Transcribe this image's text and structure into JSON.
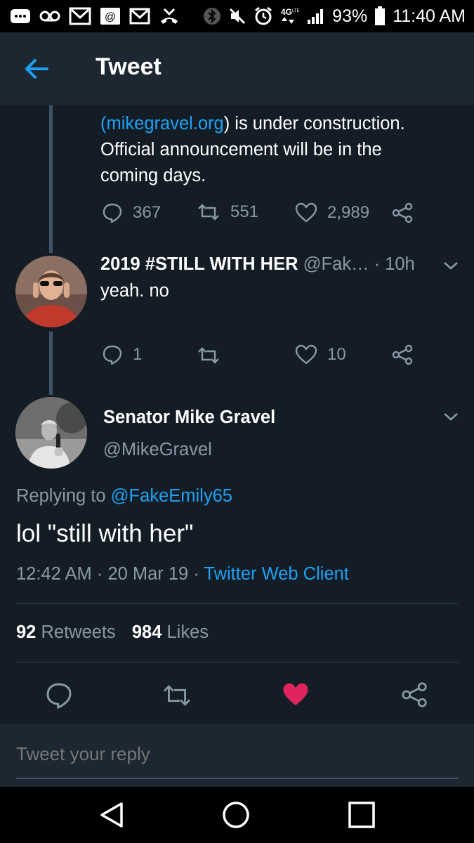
{
  "status_bar": {
    "battery": "93%",
    "time": "11:40 AM",
    "network": "4G LTE"
  },
  "header": {
    "title": "Tweet"
  },
  "parent_tweet": {
    "text_link": "mikegravel.org",
    "text_after_link": ") is under construction.",
    "text_line2": "Official announcement will be in the",
    "text_line3": "coming days.",
    "open_paren": "(",
    "replies": "367",
    "retweets": "551",
    "likes": "2,989"
  },
  "reply_tweet": {
    "display_name": "2019 #STILL WITH HER",
    "handle_truncated": "@Fak…",
    "time": "· 10h",
    "text": "yeah. no",
    "replies": "1",
    "retweets": "",
    "likes": "10"
  },
  "main_tweet": {
    "display_name": "Senator Mike Gravel",
    "handle": "@MikeGravel",
    "replying_prefix": "Replying to",
    "replying_to": "@FakeEmily65",
    "text": "lol \"still with her\"",
    "timestamp": "12:42 AM · 20 Mar 19 ·",
    "client": "Twitter Web Client",
    "retweet_count": "92",
    "retweet_label": "Retweets",
    "like_count": "984",
    "like_label": "Likes",
    "liked": true
  },
  "reply_box": {
    "placeholder": "Tweet your reply"
  },
  "colors": {
    "background": "#141d26",
    "appbar": "#1c2732",
    "accent": "#1da1f2",
    "muted": "#8899a6",
    "like": "#e0245e"
  }
}
